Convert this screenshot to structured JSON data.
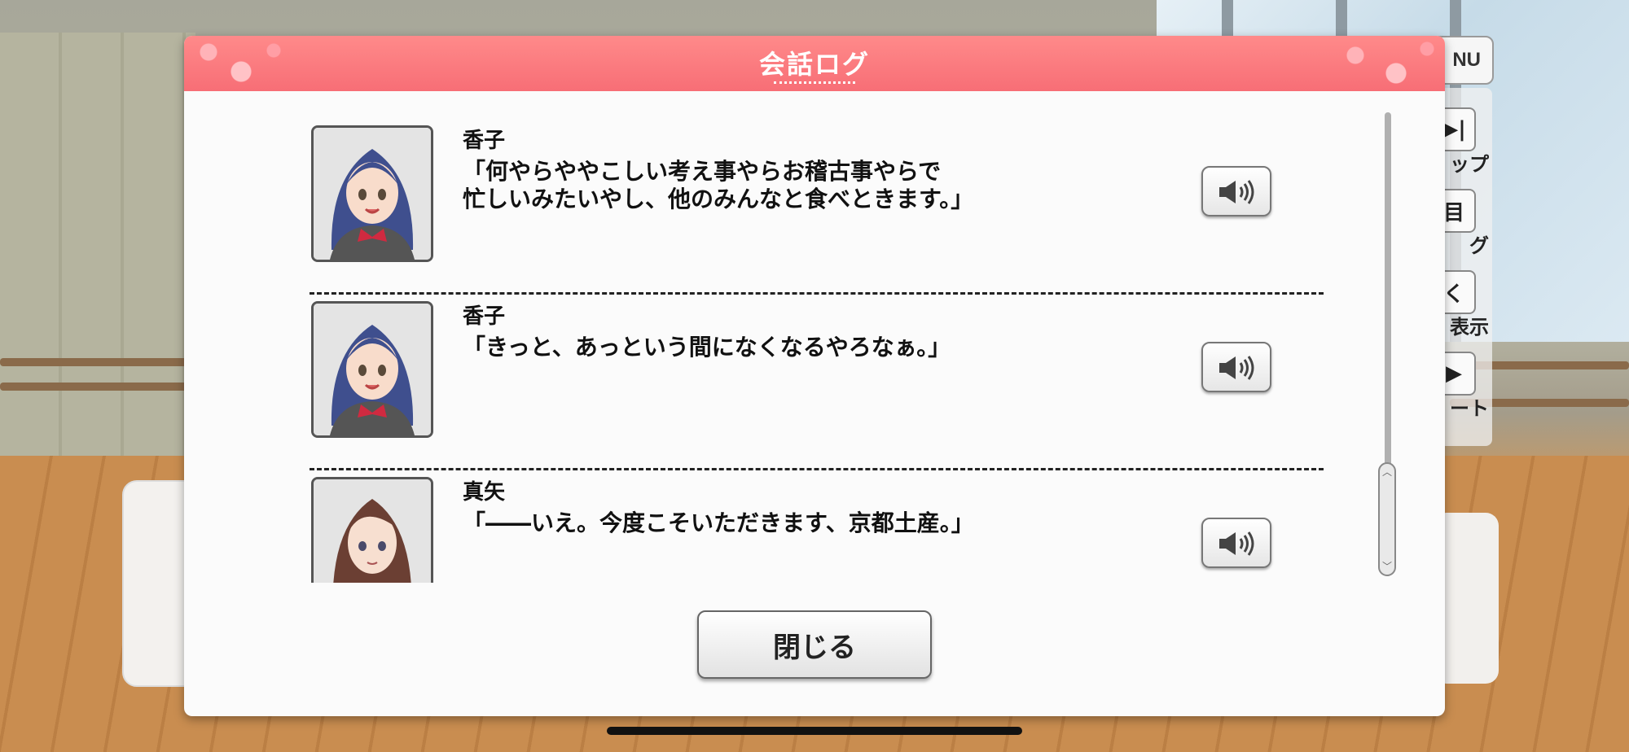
{
  "dialog": {
    "title": "会話ログ",
    "close_label": "閉じる"
  },
  "log": [
    {
      "speaker": "香子",
      "line": "「何やらややこしい考え事やらお稽古事やらで\n忙しいみたいやし、他のみんなと食べときます。」",
      "hair_color": "#3f4f8e"
    },
    {
      "speaker": "香子",
      "line": "「きっと、あっという間になくなるやろなぁ。」",
      "hair_color": "#3f4f8e"
    },
    {
      "speaker": "真矢",
      "line": "「――いえ。今度こそいただきます、京都土産。」",
      "hair_color": "#6b3f33"
    }
  ],
  "background_ui": {
    "menu_label": "NU",
    "side_items": [
      {
        "label": "ップ",
        "icon": "skip-icon",
        "glyph": "▶|"
      },
      {
        "label": "グ",
        "icon": "log-icon",
        "glyph": "目"
      },
      {
        "label": "表示",
        "icon": "hide-icon",
        "glyph": "く"
      },
      {
        "label": "ート",
        "icon": "auto-icon",
        "glyph": "▶"
      }
    ]
  },
  "colors": {
    "header": "#f76e76",
    "accent_spark": "#ffb3b8"
  }
}
